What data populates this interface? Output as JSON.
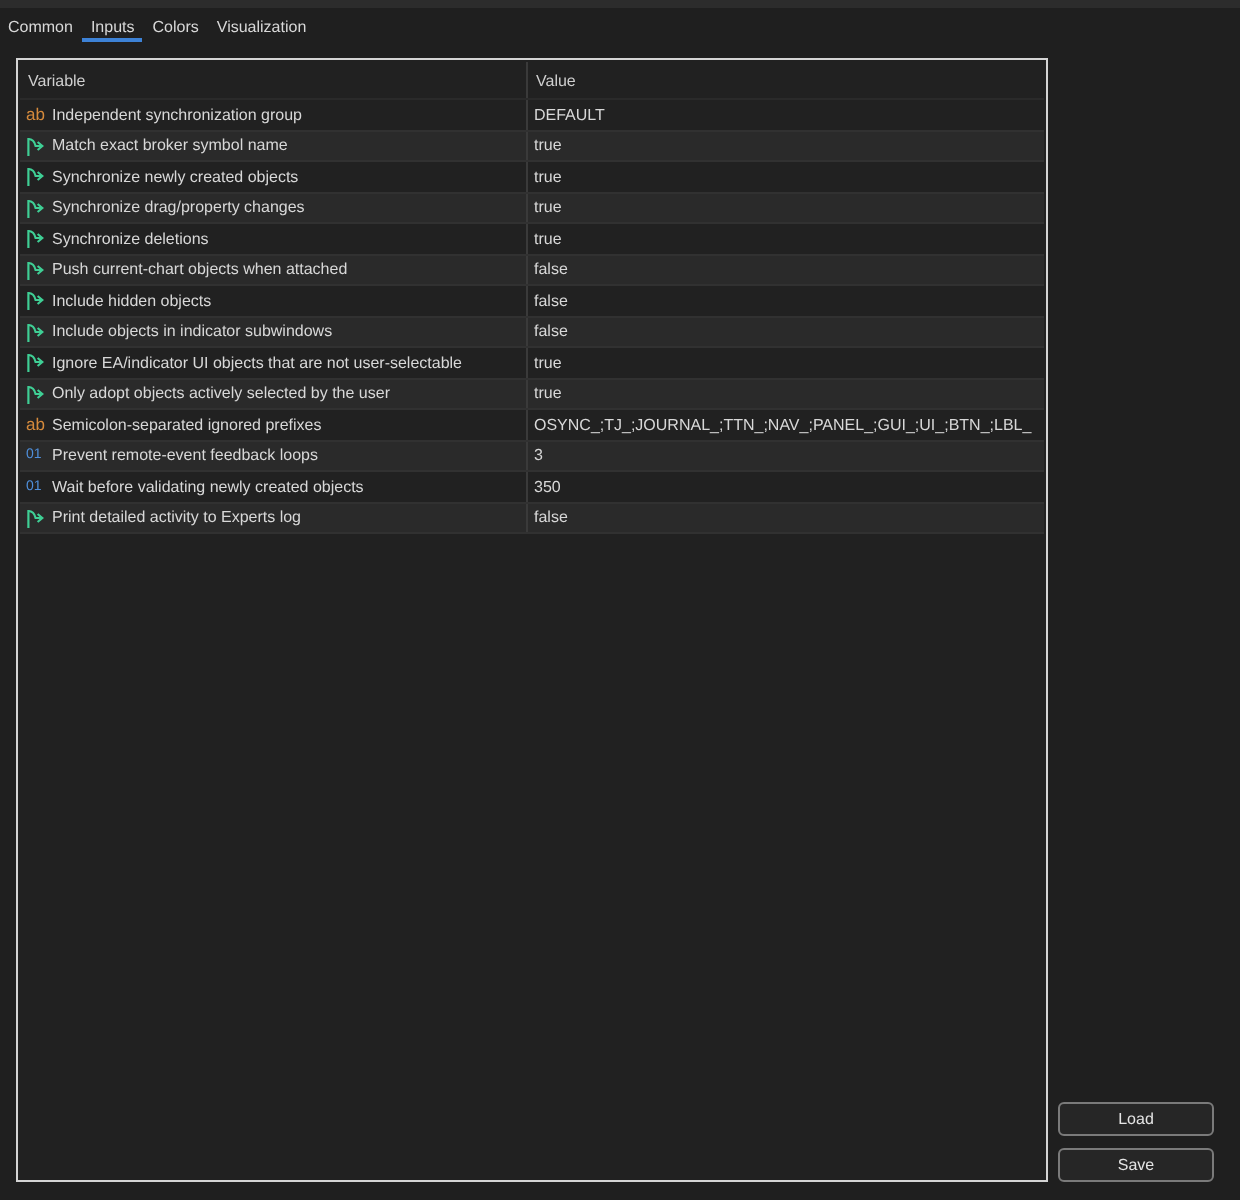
{
  "tabs": [
    {
      "label": "Common",
      "selected": false
    },
    {
      "label": "Inputs",
      "selected": true
    },
    {
      "label": "Colors",
      "selected": false
    },
    {
      "label": "Visualization",
      "selected": false
    }
  ],
  "table": {
    "columns": [
      "Variable",
      "Value"
    ],
    "rows": [
      {
        "kind": "string",
        "type_mark": "ab",
        "variable": "Independent synchronization group",
        "value": "DEFAULT"
      },
      {
        "kind": "bool",
        "variable": "Match exact broker symbol name",
        "value": "true"
      },
      {
        "kind": "bool",
        "variable": "Synchronize newly created objects",
        "value": "true"
      },
      {
        "kind": "bool",
        "variable": "Synchronize drag/property changes",
        "value": "true"
      },
      {
        "kind": "bool",
        "variable": "Synchronize deletions",
        "value": "true"
      },
      {
        "kind": "bool",
        "variable": "Push current-chart objects when attached",
        "value": "false"
      },
      {
        "kind": "bool",
        "variable": "Include hidden objects",
        "value": "false"
      },
      {
        "kind": "bool",
        "variable": "Include objects in indicator subwindows",
        "value": "false"
      },
      {
        "kind": "bool",
        "variable": "Ignore EA/indicator UI objects that are not user-selectable",
        "value": "true"
      },
      {
        "kind": "bool",
        "variable": "Only adopt objects actively selected by the user",
        "value": "true"
      },
      {
        "kind": "string",
        "type_mark": "ab",
        "variable": "Semicolon-separated ignored prefixes",
        "value": "OSYNC_;TJ_;JOURNAL_;TTN_;NAV_;PANEL_;GUI_;UI_;BTN_;LBL_"
      },
      {
        "kind": "int",
        "type_mark": "01",
        "variable": "Prevent remote-event feedback loops",
        "value": "3"
      },
      {
        "kind": "int",
        "type_mark": "01",
        "variable": "Wait before validating newly created objects",
        "value": "350"
      },
      {
        "kind": "bool",
        "variable": "Print detailed activity to Experts log",
        "value": "false"
      }
    ]
  },
  "buttons": [
    "Load",
    "Save"
  ]
}
